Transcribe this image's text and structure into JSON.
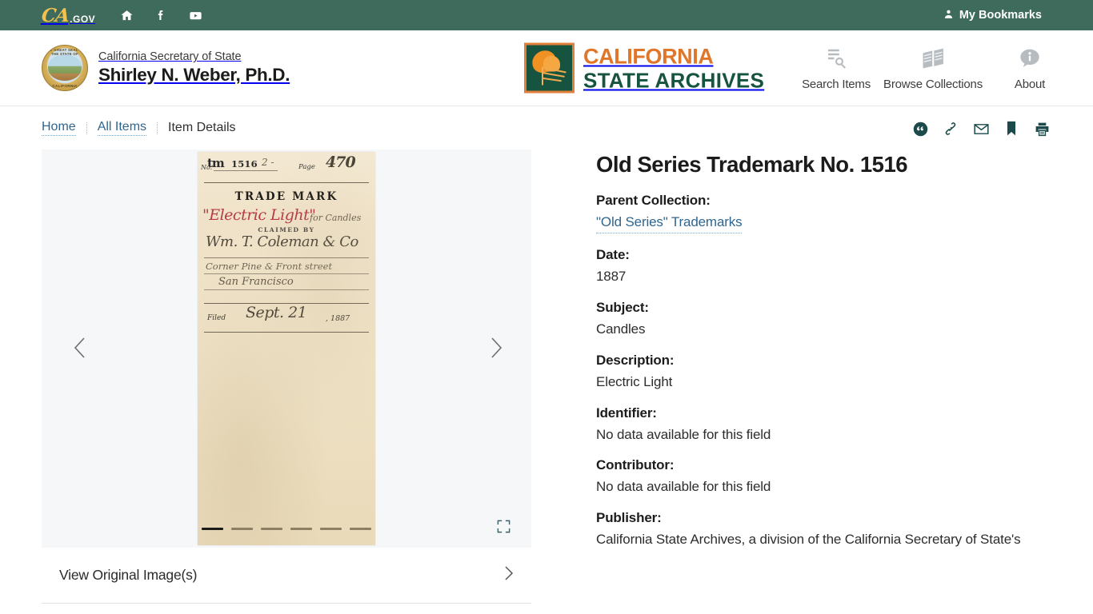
{
  "topbar": {
    "logo_ca": "CA",
    "logo_gov": ".GOV",
    "icons": [
      "home-icon",
      "facebook-icon",
      "youtube-icon"
    ],
    "bookmarks_label": "My Bookmarks"
  },
  "header": {
    "agency_sub": "California Secretary of State",
    "agency_name": "Shirley N. Weber, Ph.D.",
    "seal_top_text": "THE GREAT SEAL OF THE STATE OF",
    "seal_bottom_text": "CALIFORNIA",
    "archives_line1": "CALIFORNIA",
    "archives_line2": "STATE ARCHIVES",
    "nav": [
      {
        "label": "Search Items",
        "icon": "search-items-icon"
      },
      {
        "label": "Browse Collections",
        "icon": "browse-collections-icon"
      },
      {
        "label": "About",
        "icon": "about-info-icon"
      }
    ]
  },
  "breadcrumb": {
    "home": "Home",
    "all_items": "All Items",
    "current": "Item Details"
  },
  "actions": [
    {
      "name": "cite-icon",
      "title": "Cite"
    },
    {
      "name": "link-icon",
      "title": "Copy Link"
    },
    {
      "name": "email-icon",
      "title": "Email"
    },
    {
      "name": "bookmark-icon",
      "title": "Bookmark"
    },
    {
      "name": "print-icon",
      "title": "Print"
    }
  ],
  "viewer": {
    "total_slides": 6,
    "active_slide": 1,
    "prev_label": "Previous image",
    "next_label": "Next image",
    "fullscreen_label": "View fullscreen",
    "view_original_label": "View Original Image(s)",
    "document": {
      "tm_mark": "tm",
      "tm_number": "1516",
      "tm_scrawl": "2 -",
      "no_label": "No.",
      "page_label": "Page",
      "page_number": "470",
      "heading": "TRADE MARK",
      "trademark_name": "\"Electric Light\"",
      "trademark_suffix": "for Candles",
      "claimed_by_label": "CLAIMED BY",
      "claimant": "Wm. T. Coleman & Co",
      "address": "Corner Pine & Front street",
      "city": "San Francisco",
      "filed_label": "Filed",
      "filed_date": "Sept. 21",
      "filed_year": ", 1887"
    }
  },
  "item": {
    "title": "Old Series Trademark No. 1516",
    "fields": [
      {
        "label": "Parent Collection:",
        "value": "\"Old Series\" Trademarks",
        "is_link": true
      },
      {
        "label": "Date:",
        "value": "1887",
        "is_link": false
      },
      {
        "label": "Subject:",
        "value": "Candles",
        "is_link": false
      },
      {
        "label": "Description:",
        "value": "Electric Light",
        "is_link": false
      },
      {
        "label": "Identifier:",
        "value": "No data available for this field",
        "is_link": false
      },
      {
        "label": "Contributor:",
        "value": "No data available for this field",
        "is_link": false
      },
      {
        "label": "Publisher:",
        "value": "California State Archives, a division of the California Secretary of State's",
        "is_link": false
      }
    ]
  },
  "colors": {
    "topbar_green": "#3e6b5b",
    "archives_orange": "#e0762a",
    "archives_green": "#16543f",
    "link_blue": "#2f6690",
    "action_icon": "#1c4a4a"
  }
}
